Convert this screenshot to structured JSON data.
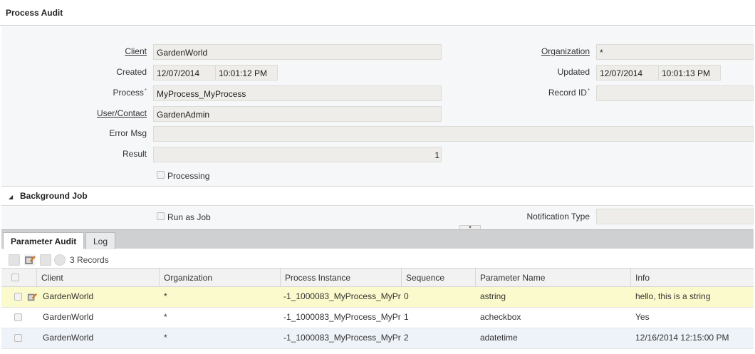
{
  "window": {
    "title": "Process Audit"
  },
  "form": {
    "client_label": "Client",
    "client_value": "GardenWorld",
    "organization_label": "Organization",
    "organization_value": "*",
    "created_label": "Created",
    "created_date": "12/07/2014",
    "created_time": "10:01:12 PM",
    "updated_label": "Updated",
    "updated_date": "12/07/2014",
    "updated_time": "10:01:13 PM",
    "process_label": "Process",
    "process_value": "MyProcess_MyProcess",
    "record_id_label": "Record ID",
    "record_id_value": "",
    "user_label": "User/Contact",
    "user_value": "GardenAdmin",
    "error_label": "Error Msg",
    "error_value": "",
    "result_label": "Result",
    "result_value": "1",
    "processing_label": "Processing",
    "required_mark": "*"
  },
  "background_job": {
    "section_title": "Background Job",
    "run_as_job_label": "Run as Job",
    "notification_type_label": "Notification Type",
    "notification_type_value": ""
  },
  "tabs": [
    {
      "label": "Parameter Audit",
      "active": true
    },
    {
      "label": "Log",
      "active": false
    }
  ],
  "toolbar": {
    "records_label": "3 Records"
  },
  "grid": {
    "columns": [
      "Client",
      "Organization",
      "Process Instance",
      "Sequence",
      "Parameter Name",
      "Info"
    ],
    "rows": [
      {
        "client": "GardenWorld",
        "organization": "*",
        "process_instance": "-1_1000083_MyProcess_MyPr",
        "sequence": "0",
        "parameter_name": "astring",
        "info": "hello, this is a string"
      },
      {
        "client": "GardenWorld",
        "organization": "*",
        "process_instance": "-1_1000083_MyProcess_MyPr",
        "sequence": "1",
        "parameter_name": "acheckbox",
        "info": "Yes"
      },
      {
        "client": "GardenWorld",
        "organization": "*",
        "process_instance": "-1_1000083_MyProcess_MyPr",
        "sequence": "2",
        "parameter_name": "adatetime",
        "info": "12/16/2014 12:15:00 PM"
      }
    ]
  },
  "colors": {
    "selected_row": "#fbfacc",
    "field_bg": "#eeede9",
    "panel_bg": "#f6f7f9",
    "tab_bar": "#cfd0d2"
  }
}
